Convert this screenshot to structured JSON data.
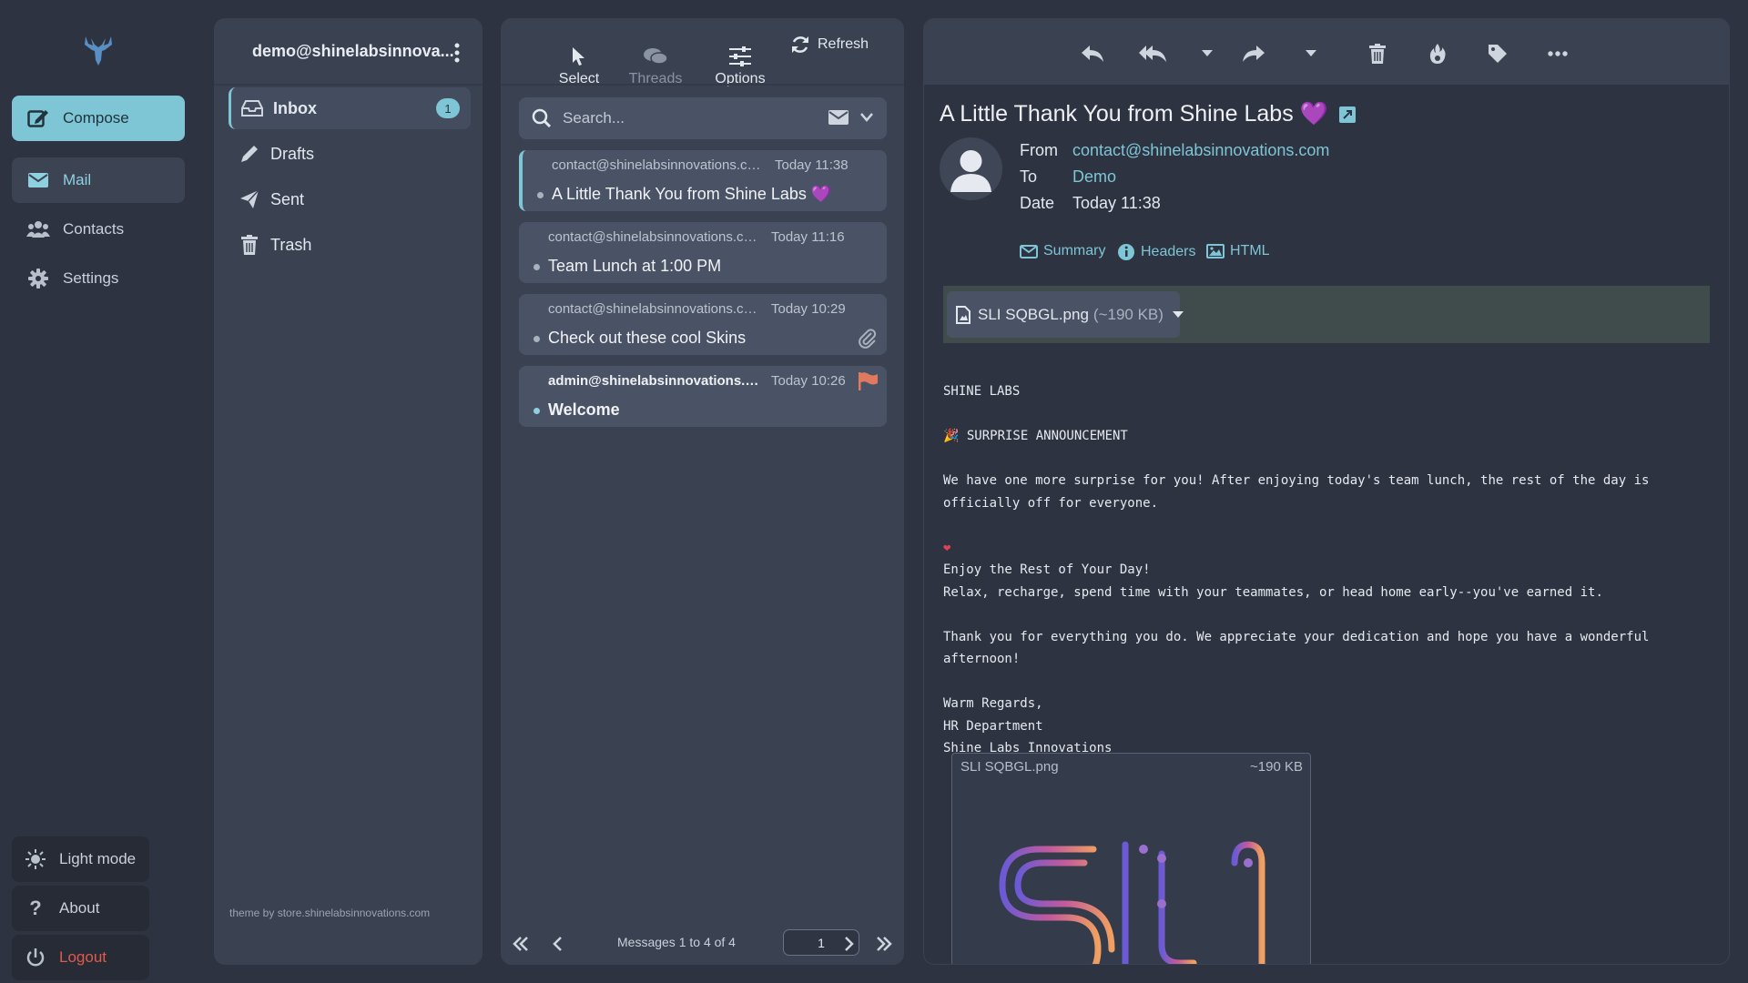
{
  "nav": {
    "compose": "Compose",
    "mail": "Mail",
    "contacts": "Contacts",
    "settings": "Settings",
    "light_mode": "Light mode",
    "about": "About",
    "logout": "Logout"
  },
  "folders": {
    "account": "demo@shinelabsinnova...",
    "items": [
      {
        "label": "Inbox",
        "count": "1",
        "icon": "inbox-icon"
      },
      {
        "label": "Drafts",
        "icon": "pencil-icon"
      },
      {
        "label": "Sent",
        "icon": "paper-plane-icon"
      },
      {
        "label": "Trash",
        "icon": "trash-icon"
      }
    ],
    "theme_credit": "theme by store.shinelabsinnovations.com"
  },
  "list_toolbar": {
    "select": "Select",
    "threads": "Threads",
    "options": "Options",
    "refresh": "Refresh"
  },
  "search": {
    "placeholder": "Search..."
  },
  "messages": [
    {
      "from": "contact@shinelabsinnovations.com",
      "time": "Today 11:38",
      "subject": "A Little Thank You from Shine Labs 💜"
    },
    {
      "from": "contact@shinelabsinnovations.com",
      "time": "Today 11:16",
      "subject": "Team Lunch at 1:00 PM"
    },
    {
      "from": "contact@shinelabsinnovations.com",
      "time": "Today 10:29",
      "subject": "Check out these cool Skins"
    },
    {
      "from": "admin@shinelabsinnovations.com",
      "time": "Today 10:26",
      "subject": "Welcome"
    }
  ],
  "pager": {
    "info": "Messages 1 to 4 of 4",
    "page": "1"
  },
  "reader": {
    "subject": "A Little Thank You from Shine Labs 💜",
    "from_label": "From",
    "from_value": "contact@shinelabsinnovations.com",
    "to_label": "To",
    "to_value": "Demo",
    "date_label": "Date",
    "date_value": "Today 11:38",
    "summary": "Summary",
    "headers": "Headers",
    "html": "HTML",
    "attachment_name": "SLI SQBGL.png",
    "attachment_size": "(~190 KB)",
    "body": {
      "line1": "SHINE LABS",
      "line2": "🎉 SURPRISE ANNOUNCEMENT",
      "line3": "We have one more surprise for you! After enjoying today's team lunch, the rest of the day is officially off for everyone.",
      "line4": "❤",
      "line5": "Enjoy the Rest of Your Day!",
      "line6": "Relax, recharge, spend time with your teammates, or head home early--you've earned it.",
      "line7": "Thank you for everything you do. We appreciate your dedication and hope you have a wonderful afternoon!",
      "line8": "Warm Regards,",
      "line9": "HR Department",
      "line10": "Shine Labs Innovations"
    },
    "preview_name": "SLI SQBGL.png",
    "preview_size": "~190 KB"
  },
  "colors": {
    "accent": "#7ec5d6",
    "logout": "#e05a4e",
    "flag": "#e07a5f",
    "background": "#2d3340",
    "panel": "#3a4252"
  }
}
